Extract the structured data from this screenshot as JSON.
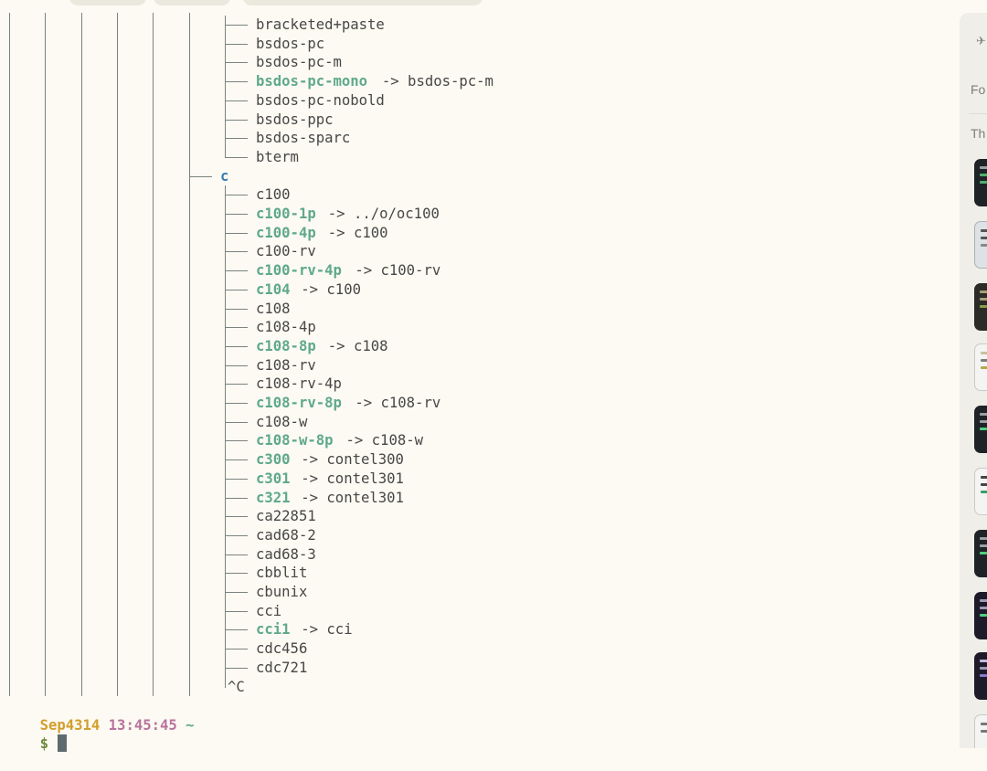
{
  "tree": {
    "entries": [
      {
        "name": "bracketed+paste",
        "kind": "file"
      },
      {
        "name": "bsdos-pc",
        "kind": "file"
      },
      {
        "name": "bsdos-pc-m",
        "kind": "file"
      },
      {
        "name": "bsdos-pc-mono",
        "kind": "link",
        "target": "bsdos-pc-m"
      },
      {
        "name": "bsdos-pc-nobold",
        "kind": "file"
      },
      {
        "name": "bsdos-ppc",
        "kind": "file"
      },
      {
        "name": "bsdos-sparc",
        "kind": "file"
      },
      {
        "name": "bterm",
        "kind": "file",
        "last": true
      },
      {
        "name": "c",
        "kind": "dir"
      },
      {
        "name": "c100",
        "kind": "file"
      },
      {
        "name": "c100-1p",
        "kind": "link",
        "target": "../o/oc100"
      },
      {
        "name": "c100-4p",
        "kind": "link",
        "target": "c100"
      },
      {
        "name": "c100-rv",
        "kind": "file"
      },
      {
        "name": "c100-rv-4p",
        "kind": "link",
        "target": "c100-rv"
      },
      {
        "name": "c104",
        "kind": "link",
        "target": "c100"
      },
      {
        "name": "c108",
        "kind": "file"
      },
      {
        "name": "c108-4p",
        "kind": "file"
      },
      {
        "name": "c108-8p",
        "kind": "link",
        "target": "c108"
      },
      {
        "name": "c108-rv",
        "kind": "file"
      },
      {
        "name": "c108-rv-4p",
        "kind": "file"
      },
      {
        "name": "c108-rv-8p",
        "kind": "link",
        "target": "c108-rv"
      },
      {
        "name": "c108-w",
        "kind": "file"
      },
      {
        "name": "c108-w-8p",
        "kind": "link",
        "target": "c108-w"
      },
      {
        "name": "c300",
        "kind": "link",
        "target": "contel300"
      },
      {
        "name": "c301",
        "kind": "link",
        "target": "contel301"
      },
      {
        "name": "c321",
        "kind": "link",
        "target": "contel301"
      },
      {
        "name": "ca22851",
        "kind": "file"
      },
      {
        "name": "cad68-2",
        "kind": "file"
      },
      {
        "name": "cad68-3",
        "kind": "file"
      },
      {
        "name": "cbblit",
        "kind": "file"
      },
      {
        "name": "cbunix",
        "kind": "file"
      },
      {
        "name": "cci",
        "kind": "file"
      },
      {
        "name": "cci1",
        "kind": "link",
        "target": "cci"
      },
      {
        "name": "cdc456",
        "kind": "file"
      },
      {
        "name": "cdc721",
        "kind": "file"
      }
    ],
    "interrupt": "^C",
    "arrow": "->"
  },
  "prompt": {
    "host": "Sep4314",
    "time": "13:45:45",
    "cwd": "~",
    "symbol": "$"
  },
  "sidebar": {
    "label_1": "Fo",
    "label_2": "Th"
  },
  "colors": {
    "background": "#fcfaf2",
    "text": "#474747",
    "symlink": "#5fa98a",
    "directory": "#3c7db4",
    "prompt_host": "#d39e2b",
    "prompt_time": "#b7739d"
  }
}
